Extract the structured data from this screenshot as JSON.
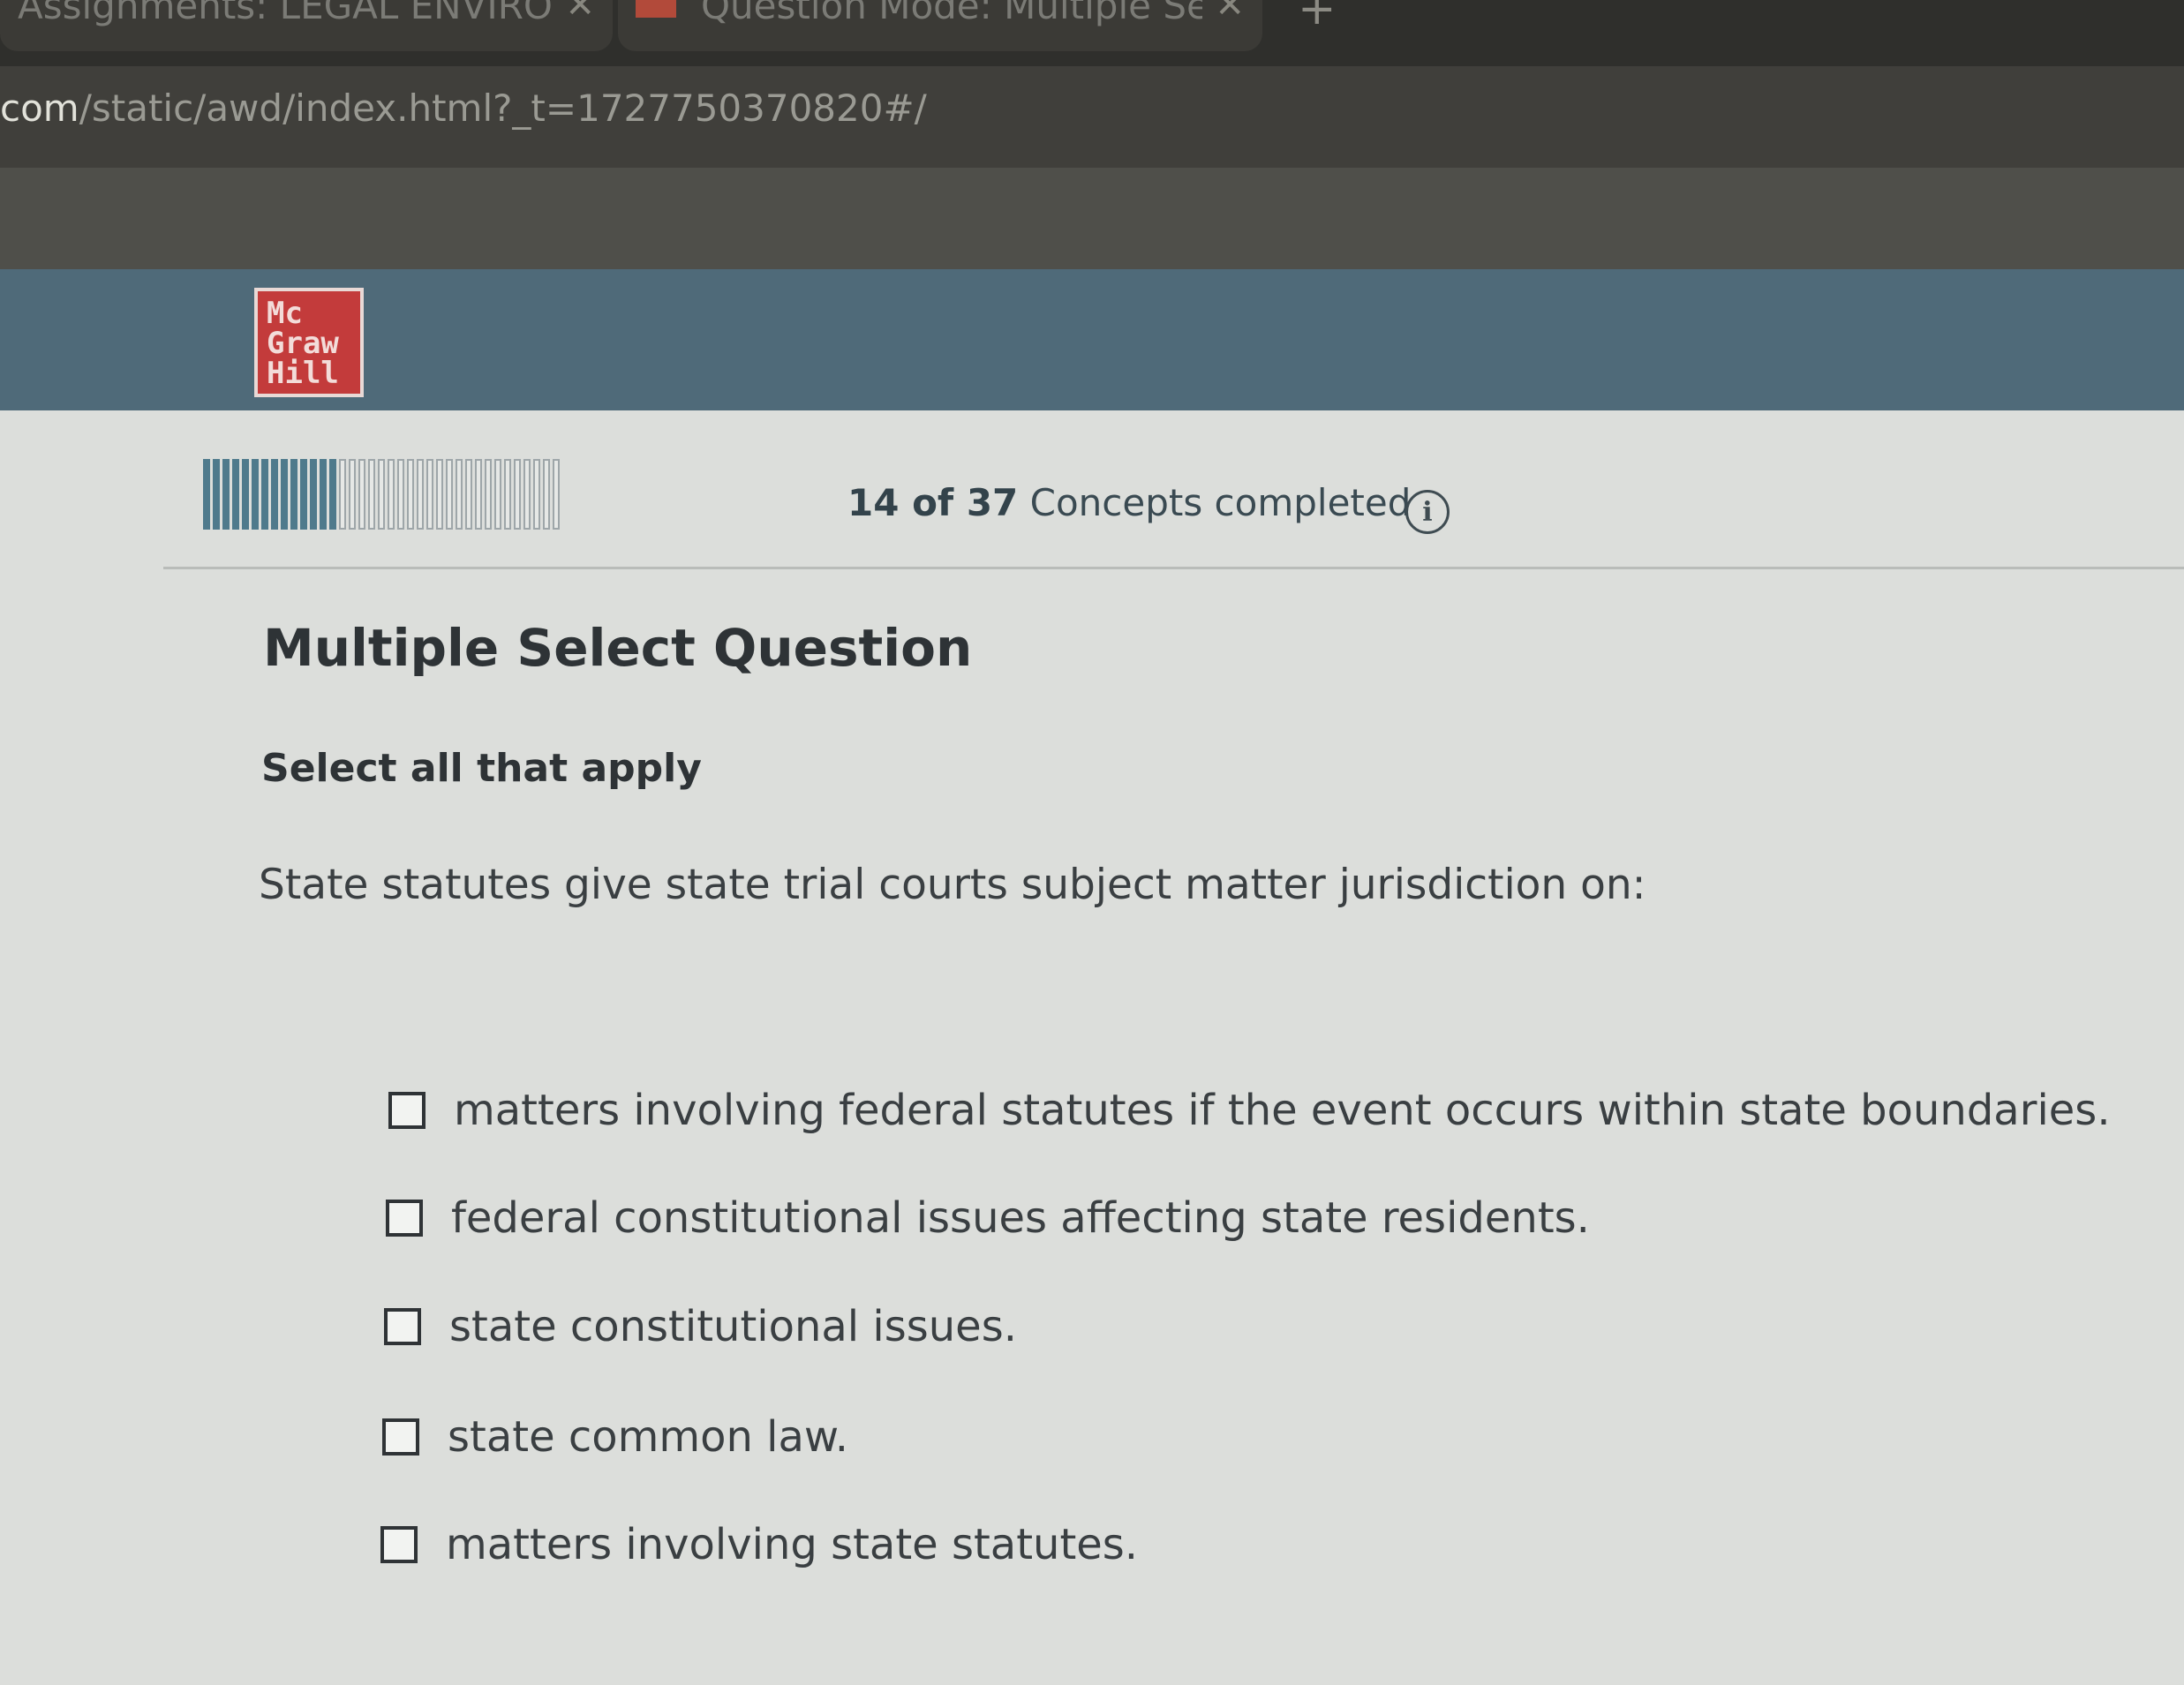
{
  "browser": {
    "tabs": [
      {
        "label": "Assignments: LEGAL ENVIRON",
        "close": "✕"
      },
      {
        "label": "Question Mode: Multiple Selec",
        "close": "✕"
      }
    ],
    "new_tab": "+",
    "url_host": "com",
    "url_path": "/static/awd/index.html?_t=1727750370820#/"
  },
  "header": {
    "logo_lines": [
      "Mc",
      "Graw",
      "Hill"
    ],
    "logo_color": "#c33b3b",
    "bar_color": "#4f6a79"
  },
  "progress": {
    "completed": 14,
    "total": 37,
    "count_text": "14 of 37",
    "label": "Concepts completed",
    "info_icon": "info-icon"
  },
  "question": {
    "title": "Multiple Select Question",
    "instruction": "Select all that apply",
    "prompt": "State statutes give state trial courts subject matter jurisdiction on:",
    "options": [
      {
        "label": "matters involving federal statutes if the event occurs within state boundaries.",
        "checked": false
      },
      {
        "label": "federal constitutional issues affecting state residents.",
        "checked": false
      },
      {
        "label": "state constitutional issues.",
        "checked": false
      },
      {
        "label": "state common law.",
        "checked": false
      },
      {
        "label": "matters involving state statutes.",
        "checked": false
      }
    ]
  }
}
